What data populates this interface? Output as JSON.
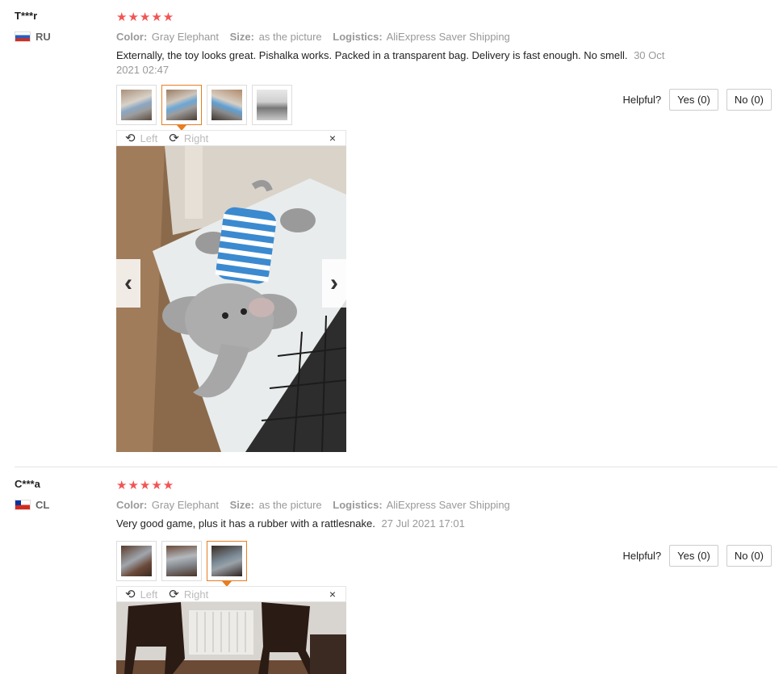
{
  "reviews": [
    {
      "user": "T***r",
      "country": "RU",
      "stars": "★★★★★",
      "color_label": "Color:",
      "color_value": "Gray Elephant",
      "size_label": "Size:",
      "size_value": "as the picture",
      "logistics_label": "Logistics:",
      "logistics_value": "AliExpress Saver Shipping",
      "text": "Externally, the toy looks great. Pishalka works. Packed in a transparent bag. Delivery is fast enough. No smell.",
      "date": "30 Oct 2021 02:47",
      "helpful_label": "Helpful?",
      "yes_label": "Yes (0)",
      "no_label": "No (0)",
      "viewer": {
        "left_label": "Left",
        "right_label": "Right",
        "close": "×",
        "prev": "‹",
        "next": "›"
      }
    },
    {
      "user": "C***a",
      "country": "CL",
      "stars": "★★★★★",
      "color_label": "Color:",
      "color_value": "Gray Elephant",
      "size_label": "Size:",
      "size_value": "as the picture",
      "logistics_label": "Logistics:",
      "logistics_value": "AliExpress Saver Shipping",
      "text": "Very good game, plus it has a rubber with a rattlesnake.",
      "date": "27 Jul 2021 17:01",
      "helpful_label": "Helpful?",
      "yes_label": "Yes (0)",
      "no_label": "No (0)",
      "viewer": {
        "left_label": "Left",
        "right_label": "Right",
        "close": "×"
      }
    }
  ],
  "icons": {
    "rotate_left": "rotate-left-icon",
    "rotate_right": "rotate-right-icon",
    "close": "close-icon",
    "chevron_left": "chevron-left-icon",
    "chevron_right": "chevron-right-icon"
  },
  "colors": {
    "stars": "#f25454",
    "active_thumb": "#e67e22",
    "meta_text": "#999999"
  }
}
